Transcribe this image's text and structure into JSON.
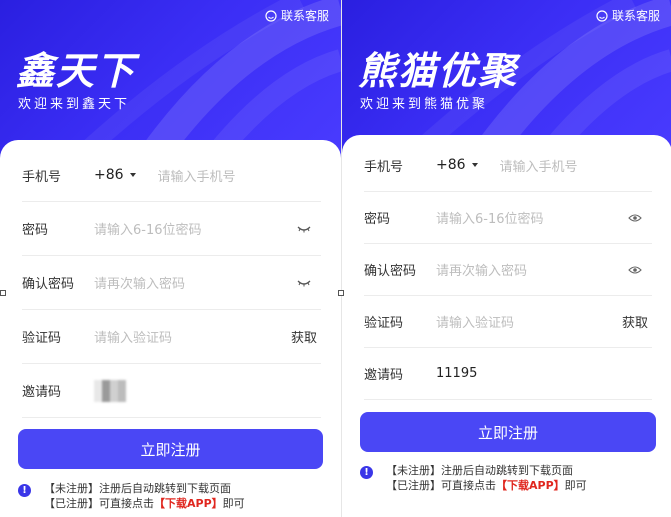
{
  "support_label": "联系客服",
  "left": {
    "brand": "鑫天下",
    "tagline": "欢迎来到鑫天下",
    "fields": [
      {
        "label": "手机号",
        "prefix": "+86",
        "placeholder": "请输入手机号"
      },
      {
        "label": "密码",
        "placeholder": "请输入6-16位密码"
      },
      {
        "label": "确认密码",
        "placeholder": "请再次输入密码"
      },
      {
        "label": "验证码",
        "placeholder": "请输入验证码",
        "action": "获取"
      },
      {
        "label": "邀请码",
        "value": ""
      }
    ],
    "submit": "立即注册",
    "notice": {
      "line1_tag": "【未注册】",
      "line1_text": "注册后自动跳转到下载页面",
      "line2_tag": "【已注册】",
      "line2_text": "可直接点击",
      "line2_link": "【下载APP】",
      "line2_end": "即可"
    }
  },
  "right": {
    "brand": "熊猫优聚",
    "tagline": "欢迎来到熊猫优聚",
    "fields": [
      {
        "label": "手机号",
        "prefix": "+86",
        "placeholder": "请输入手机号"
      },
      {
        "label": "密码",
        "placeholder": "请输入6-16位密码"
      },
      {
        "label": "确认密码",
        "placeholder": "请再次输入密码"
      },
      {
        "label": "验证码",
        "placeholder": "请输入验证码",
        "action": "获取"
      },
      {
        "label": "邀请码",
        "value": "11195"
      }
    ],
    "submit": "立即注册",
    "notice": {
      "line1_tag": "【未注册】",
      "line1_text": "注册后自动跳转到下载页面",
      "line2_tag": "【已注册】",
      "line2_text": "可直接点击",
      "line2_link": "【下载APP】",
      "line2_end": "即可"
    }
  },
  "colors": {
    "primary": "#4a47f5",
    "hero": "#3b2ef5",
    "highlight": "#e0271f"
  }
}
